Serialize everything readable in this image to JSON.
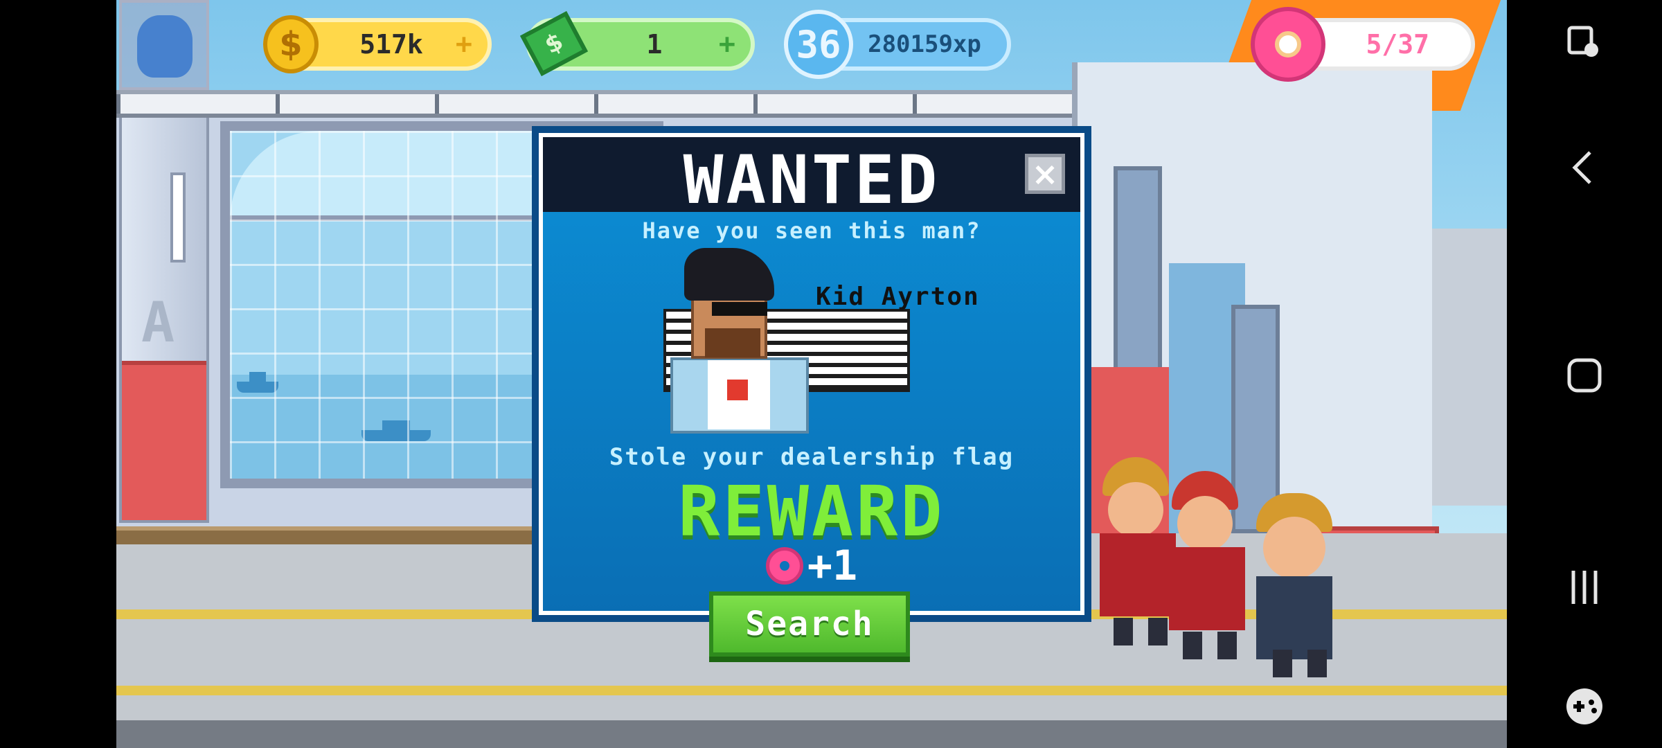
{
  "hud": {
    "coins": {
      "value": "517k",
      "plus": "+",
      "icon": "coin-icon"
    },
    "cash": {
      "value": "1",
      "plus": "+",
      "icon": "cash-icon"
    },
    "level": {
      "value": "36",
      "xp": "280159xp",
      "icon": "level-badge-icon"
    },
    "donuts": {
      "value": "5/37",
      "icon": "donut-icon"
    }
  },
  "dialog": {
    "title": "WANTED",
    "close_label": "×",
    "subtitle": "Have you seen this man?",
    "suspect_name": "Kid Ayrton",
    "crime": "Stole your dealership flag",
    "reward_label": "REWARD",
    "reward_amount": "+1",
    "reward_icon": "donut-icon",
    "search_label": "Search"
  },
  "navbar": {
    "items": [
      "screen-lock-icon",
      "back-icon",
      "home-icon",
      "recents-icon",
      "game-tools-icon"
    ]
  },
  "colors": {
    "dialog_bg": "#0b7fc6",
    "reward_green": "#7fee3a",
    "search_button": "#5cc935",
    "coin_gold": "#ffd84a",
    "cash_green": "#8ee276",
    "xp_blue": "#73c3f2",
    "donut_pink": "#ff4f95"
  }
}
